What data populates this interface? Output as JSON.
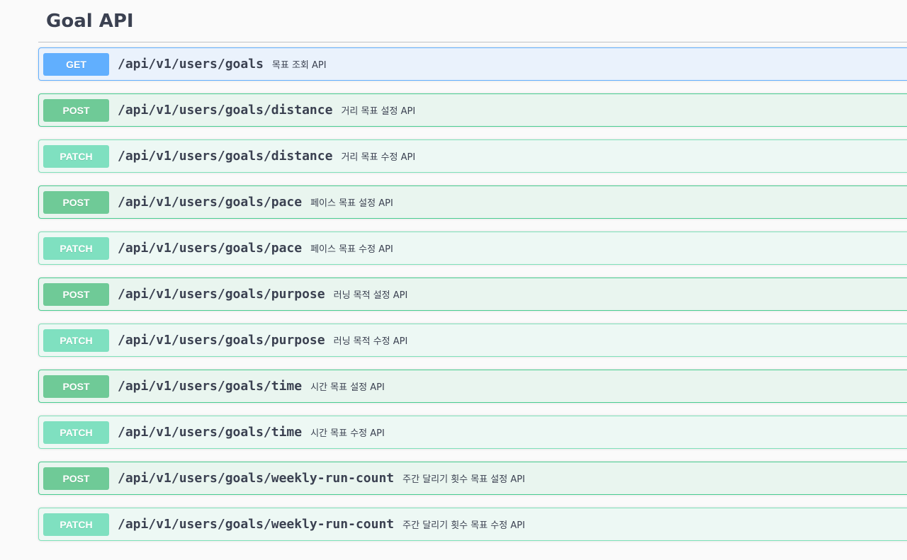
{
  "section": {
    "title": "Goal API"
  },
  "colors": {
    "get": "#61affe",
    "post": "#49cc90",
    "patch": "#50e3c2",
    "text": "#3b4151"
  },
  "operations": [
    {
      "method": "GET",
      "path": "/api/v1/users/goals",
      "summary": "목표 조회 API"
    },
    {
      "method": "POST",
      "path": "/api/v1/users/goals/distance",
      "summary": "거리 목표 설정 API"
    },
    {
      "method": "PATCH",
      "path": "/api/v1/users/goals/distance",
      "summary": "거리 목표 수정 API"
    },
    {
      "method": "POST",
      "path": "/api/v1/users/goals/pace",
      "summary": "페이스 목표 설정 API"
    },
    {
      "method": "PATCH",
      "path": "/api/v1/users/goals/pace",
      "summary": "페이스 목표 수정 API"
    },
    {
      "method": "POST",
      "path": "/api/v1/users/goals/purpose",
      "summary": "러닝 목적 설정 API"
    },
    {
      "method": "PATCH",
      "path": "/api/v1/users/goals/purpose",
      "summary": "러닝 목적 수정 API"
    },
    {
      "method": "POST",
      "path": "/api/v1/users/goals/time",
      "summary": "시간 목표 설정 API"
    },
    {
      "method": "PATCH",
      "path": "/api/v1/users/goals/time",
      "summary": "시간 목표 수정 API"
    },
    {
      "method": "POST",
      "path": "/api/v1/users/goals/weekly-run-count",
      "summary": "주간 달리기 횟수 목표 설정 API"
    },
    {
      "method": "PATCH",
      "path": "/api/v1/users/goals/weekly-run-count",
      "summary": "주간 달리기 횟수 목표 수정 API"
    }
  ]
}
